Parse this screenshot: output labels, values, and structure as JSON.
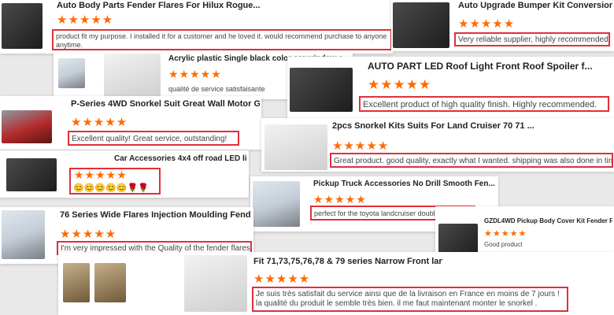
{
  "cards": [
    {
      "title": "Auto Body Parts Fender Flares For Hilux Rogue...",
      "stars": "★★★★★",
      "review": "product fit my purpose. I installed it for a customer and he loved it. would recommend purchase to anyone anytime."
    },
    {
      "title": "Auto Upgrade Bumper Kit Conversion",
      "stars": "★★★★★",
      "review": "Very reliable supplier, highly recommended."
    },
    {
      "title": "Acrylic plastic Single black color car window s...",
      "stars": "★★★★★",
      "review": "qualité de service satisfaisante"
    },
    {
      "title": "AUTO PART LED Roof Light Front Roof Spoiler f...",
      "stars": "★★★★★",
      "review": "Excellent product of high quality finish. Highly recommended."
    },
    {
      "title": "P-Series 4WD Snorkel Suit Great Wall Motor G...",
      "stars": "★★★★★",
      "review": "Excellent quality! Great service, outstanding!"
    },
    {
      "title": "2pcs Snorkel Kits Suits For Land Cruiser 70 71 ...",
      "stars": "★★★★★",
      "review": "Great product. good quality, exactly what I wanted. shipping was also done in time."
    },
    {
      "title": "Car Accessories 4x4 off road LED li...",
      "stars": "★★★★★",
      "review": "😊😊😊😊😊🌹🌹🌹"
    },
    {
      "title": "Pickup Truck Accessories No Drill Smooth Fen...",
      "stars": "★★★★★",
      "review": "perfect for the toyota landcruiser double cab 👍🏼👍🏼"
    },
    {
      "title": "GZDL4WD Pickup Body Cover Kit Fender Flare...",
      "stars": "★★★★★",
      "review": "Good product"
    },
    {
      "title": "76 Series Wide Flares Injection Moulding Fend...",
      "stars": "★★★★★",
      "review": "I'm very impressed with the Quality of the fender flares."
    },
    {
      "title": "Fit 71,73,75,76,78 & 79 series Narrow Front lan...",
      "stars": "★★★★★",
      "review": "Je suis très satisfait du service ainsi que de la livraison en France en moins de 7 jours ! la qualité du produit le semble très bien. il me faut maintenant monter le snorkel ."
    }
  ]
}
